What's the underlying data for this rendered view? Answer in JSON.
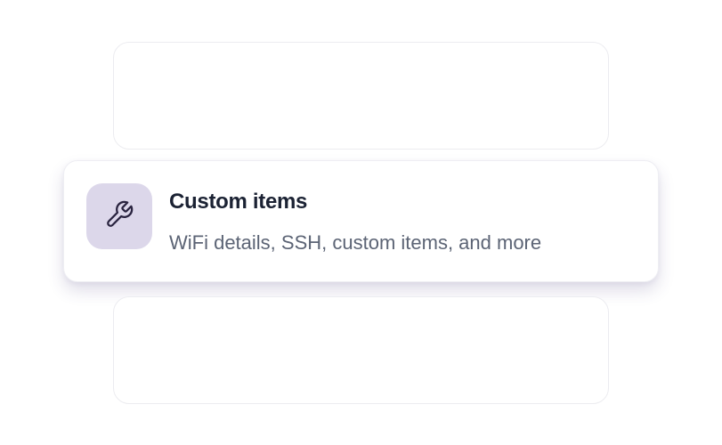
{
  "feature": {
    "icon": "wrench-icon",
    "title": "Custom items",
    "description": "WiFi details, SSH, custom items, and more"
  },
  "colors": {
    "icon_tile_bg": "#dcd7ea",
    "icon_stroke": "#2a2440",
    "title": "#1b2233",
    "description": "#5c6475"
  }
}
